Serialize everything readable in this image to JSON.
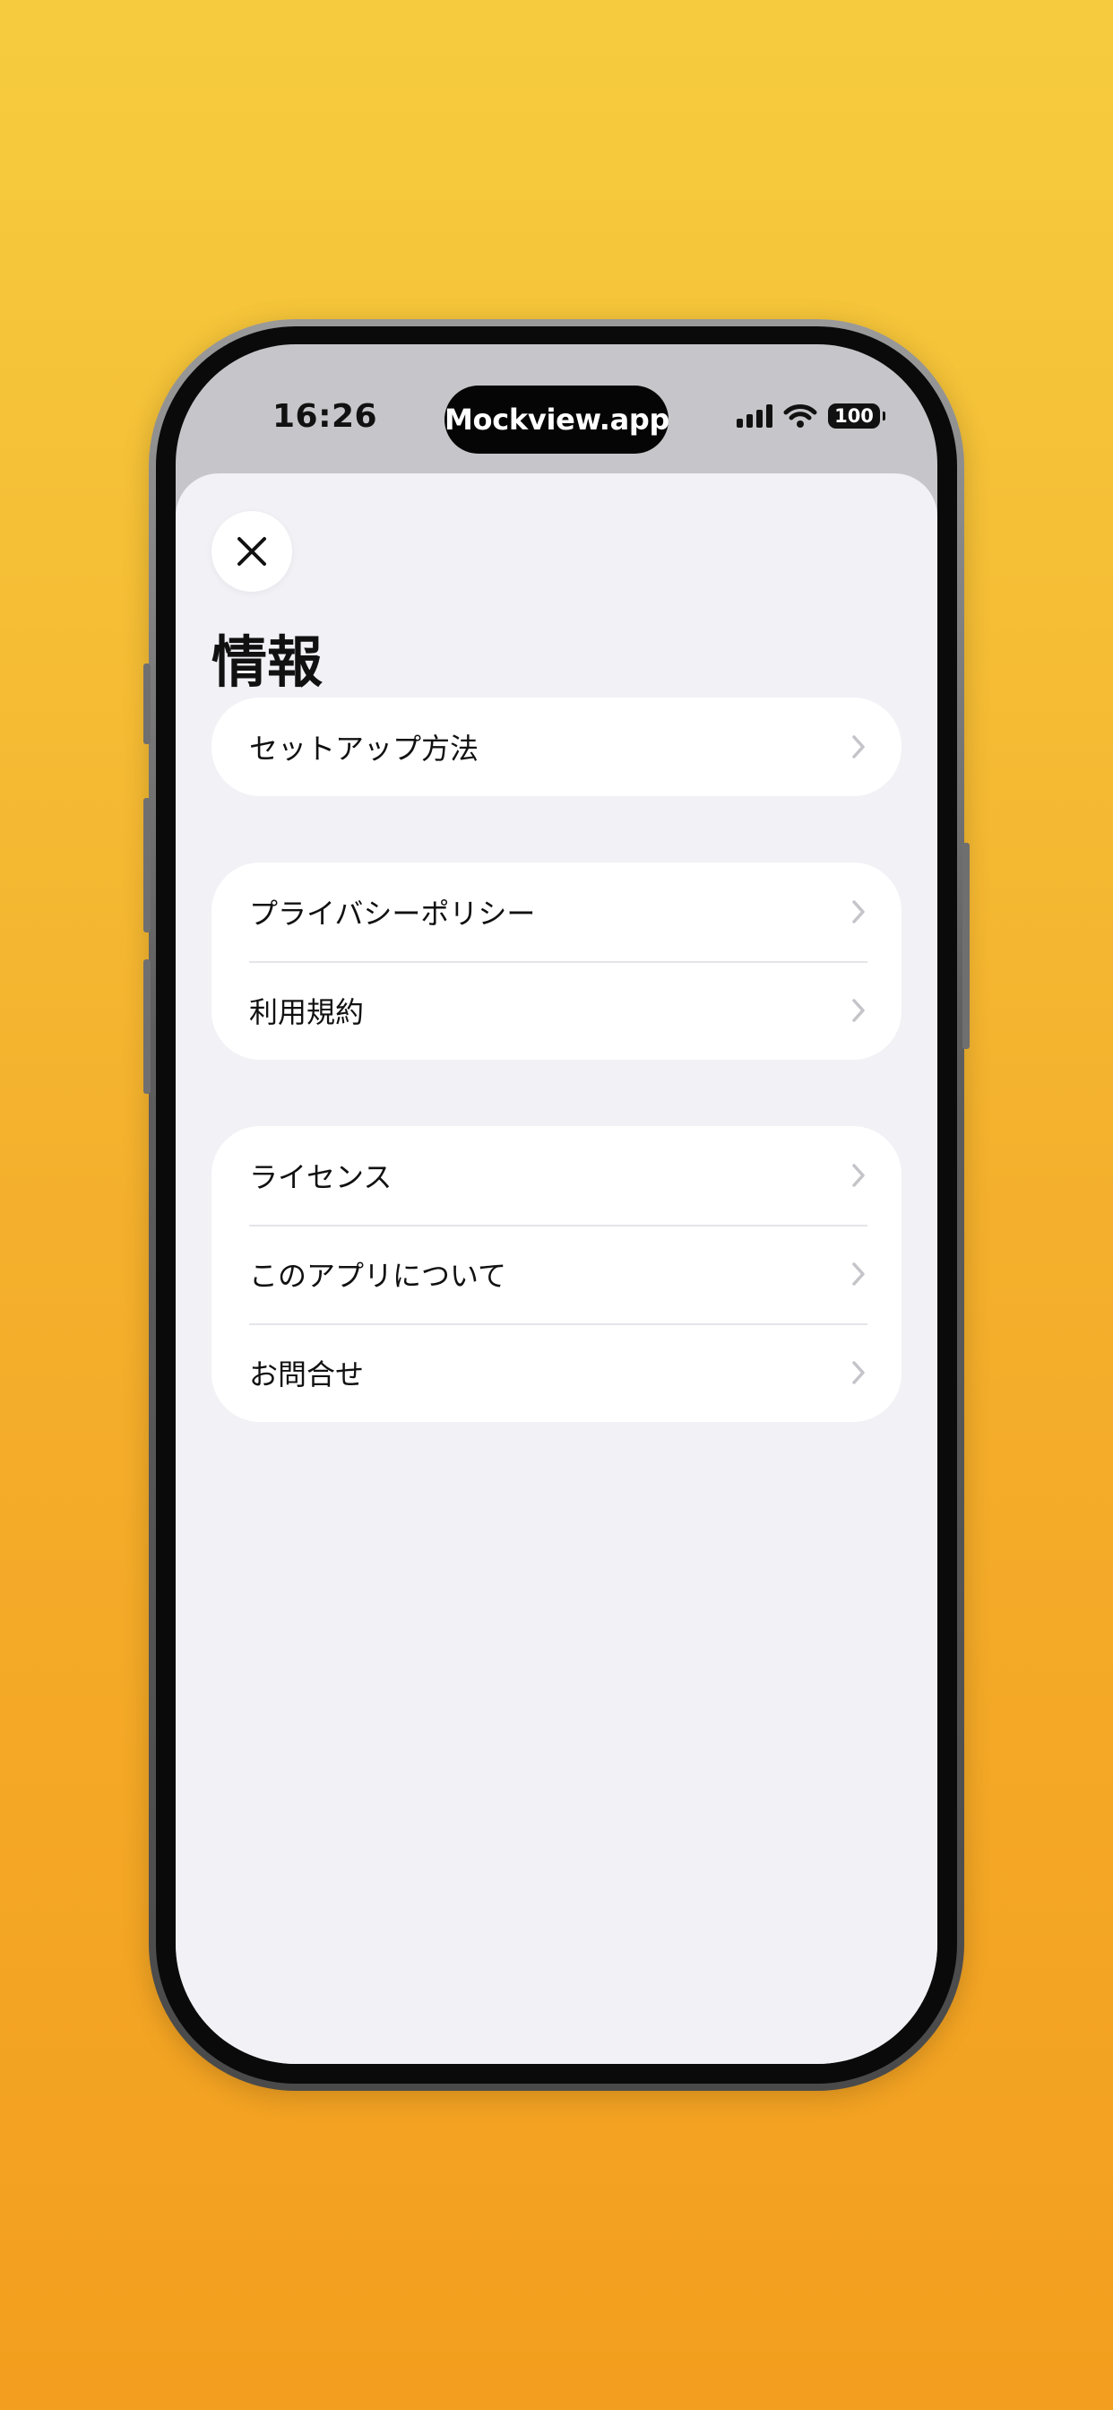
{
  "status_bar": {
    "time": "16:26",
    "island_label": "Mockview.app",
    "battery": "100"
  },
  "sheet": {
    "title": "情報",
    "close_icon": "close-icon",
    "groups": [
      {
        "rows": [
          {
            "label": "セットアップ方法"
          }
        ]
      },
      {
        "rows": [
          {
            "label": "プライバシーポリシー"
          },
          {
            "label": "利用規約"
          }
        ]
      },
      {
        "rows": [
          {
            "label": "ライセンス"
          },
          {
            "label": "このアプリについて"
          },
          {
            "label": "お問合せ"
          }
        ]
      }
    ]
  },
  "colors": {
    "background_top": "#f6cc3e",
    "background_bottom": "#f39e1e",
    "sheet": "#f1f1f6",
    "card": "#ffffff",
    "chevron": "#c4c4c9"
  }
}
